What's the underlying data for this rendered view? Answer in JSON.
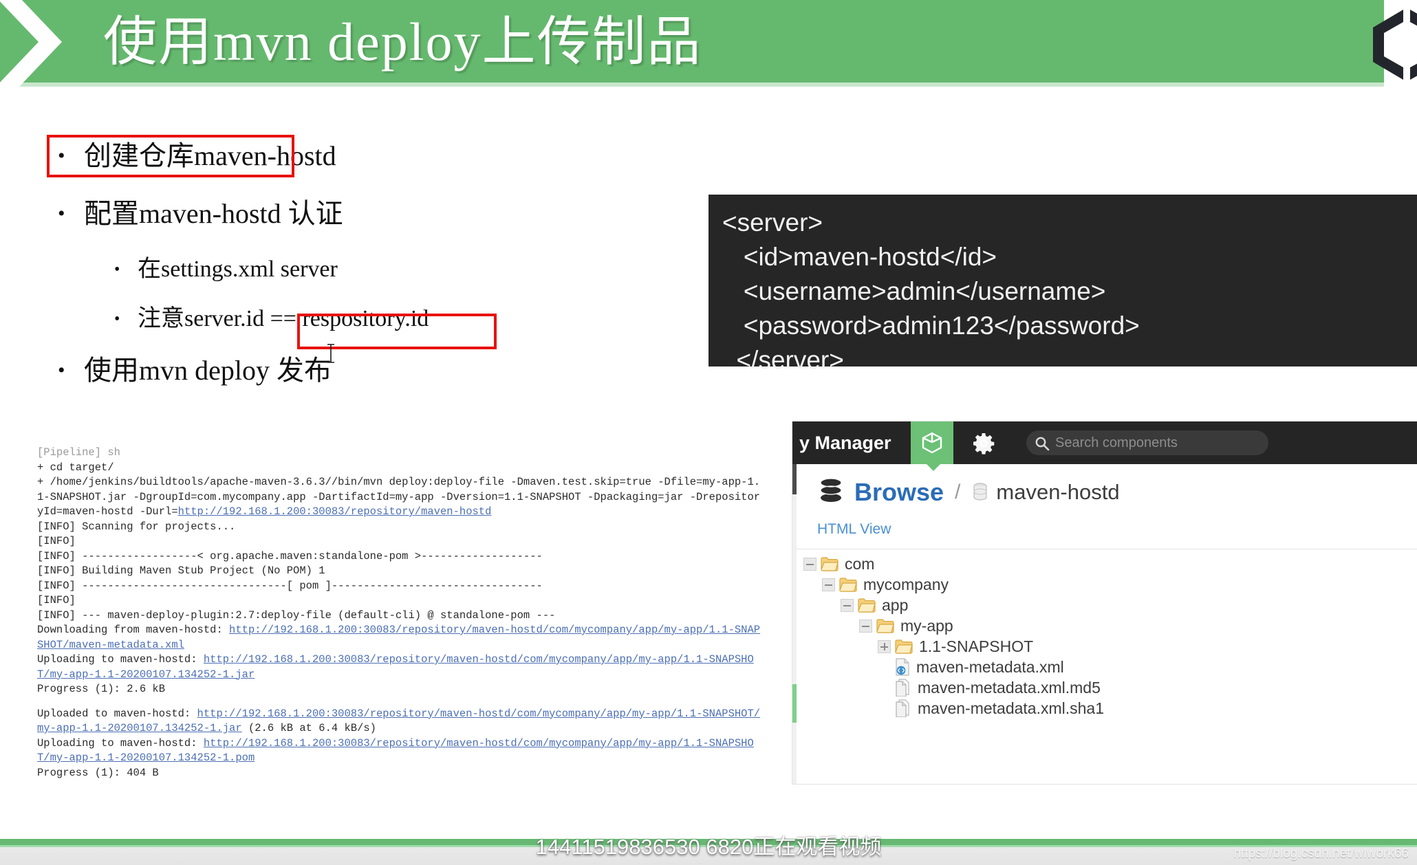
{
  "header": {
    "title": "使用mvn deploy上传制品",
    "chevron_icon": "chevron-right-icon",
    "logo_icon": "nexus-hexagon-logo-icon",
    "band_color": "#65b96e"
  },
  "bullets": {
    "items": [
      {
        "level": 1,
        "cn": "创建仓库",
        "code": "maven-hostd",
        "tail": "",
        "highlight": true
      },
      {
        "level": 1,
        "cn": "配置",
        "code": "maven-hostd",
        "tail": " 认证",
        "highlight": false
      },
      {
        "level": 2,
        "cn": "在",
        "code": "settings.xml server",
        "tail": "",
        "highlight": false
      },
      {
        "level": 2,
        "cn": "注意",
        "code": "server.id == ",
        "tail": "",
        "highlight": false,
        "boxed_code": "respository.id"
      },
      {
        "level": 1,
        "cn": "使用",
        "code": "mvn deploy",
        "tail": " 发布",
        "highlight": false
      }
    ],
    "full_lines": [
      "创建仓库maven-hostd",
      "配置maven-hostd 认证",
      "在settings.xml server",
      "注意server.id == respository.id",
      "使用mvn deploy 发布"
    ],
    "highlight_color": "#e8120d"
  },
  "xml_block": {
    "lines": [
      "<server>",
      "   <id>maven-hostd</id>",
      "   <username>admin</username>",
      "   <password>admin123</password>",
      "  </server>"
    ],
    "background": "#262626",
    "text_color": "#f2f2f2"
  },
  "console": {
    "lines": [
      {
        "text": "[Pipeline] sh",
        "style": "gray"
      },
      {
        "text": "+ cd target/",
        "style": "plain"
      },
      {
        "text": "+ /home/jenkins/buildtools/apache-maven-3.6.3//bin/mvn deploy:deploy-file -Dmaven.test.skip=true -Dfile=my-app-1.1-SNAPSHOT.jar -DgroupId=com.mycompany.app -DartifactId=my-app -Dversion=1.1-SNAPSHOT -Dpackaging=jar -DrepositoryId=maven-hostd -Durl=",
        "style": "plain",
        "url": "http://192.168.1.200:30083/repository/maven-hostd"
      },
      {
        "text": "[INFO] Scanning for projects...",
        "style": "plain"
      },
      {
        "text": "[INFO]",
        "style": "plain"
      },
      {
        "text": "[INFO] ------------------< org.apache.maven:standalone-pom >-------------------",
        "style": "plain"
      },
      {
        "text": "[INFO] Building Maven Stub Project (No POM) 1",
        "style": "plain"
      },
      {
        "text": "[INFO] --------------------------------[ pom ]---------------------------------",
        "style": "plain"
      },
      {
        "text": "[INFO]",
        "style": "plain"
      },
      {
        "text": "[INFO] --- maven-deploy-plugin:2.7:deploy-file (default-cli) @ standalone-pom ---",
        "style": "plain"
      },
      {
        "text": "Downloading from maven-hostd: ",
        "style": "plain",
        "url": "http://192.168.1.200:30083/repository/maven-hostd/com/mycompany/app/my-app/1.1-SNAPSHOT/maven-metadata.xml"
      },
      {
        "text": "Uploading to maven-hostd: ",
        "style": "plain",
        "url": "http://192.168.1.200:30083/repository/maven-hostd/com/mycompany/app/my-app/1.1-SNAPSHOT/my-app-1.1-20200107.134252-1.jar"
      },
      {
        "text": "Progress (1): 2.6 kB",
        "style": "plain"
      },
      {
        "text": "",
        "style": "spacer"
      },
      {
        "text": "Uploaded to maven-hostd: ",
        "style": "plain",
        "url": "http://192.168.1.200:30083/repository/maven-hostd/com/mycompany/app/my-app/1.1-SNAPSHOT/my-app-1.1-20200107.134252-1.jar",
        "suffix": " (2.6 kB at 6.4 kB/s)"
      },
      {
        "text": "Uploading to maven-hostd: ",
        "style": "plain",
        "url": "http://192.168.1.200:30083/repository/maven-hostd/com/mycompany/app/my-app/1.1-SNAPSHOT/my-app-1.1-20200107.134252-1.pom"
      },
      {
        "text": "Progress (1): 404 B",
        "style": "plain"
      }
    ]
  },
  "nexus": {
    "topbar_title": "y Manager",
    "tab_browse_icon": "cube-icon",
    "gear_icon": "gear-icon",
    "search": {
      "placeholder": "Search components",
      "value": "",
      "icon": "search-icon"
    },
    "breadcrumb": {
      "root_icon": "database-stack-icon",
      "root_label": "Browse",
      "separator": "/",
      "repo_icon": "repository-icon",
      "repo_label": "maven-hostd"
    },
    "html_view_link": "HTML View",
    "tree": [
      {
        "label": "com",
        "indent": 0,
        "toggle": "minus",
        "icon": "folder-open-icon"
      },
      {
        "label": "mycompany",
        "indent": 1,
        "toggle": "minus",
        "icon": "folder-open-icon"
      },
      {
        "label": "app",
        "indent": 2,
        "toggle": "minus",
        "icon": "folder-open-icon"
      },
      {
        "label": "my-app",
        "indent": 3,
        "toggle": "minus",
        "icon": "folder-open-icon"
      },
      {
        "label": "1.1-SNAPSHOT",
        "indent": 4,
        "toggle": "plus",
        "icon": "folder-open-icon"
      },
      {
        "label": "maven-metadata.xml",
        "indent": 4,
        "toggle": "none",
        "icon": "xml-file-icon"
      },
      {
        "label": "maven-metadata.xml.md5",
        "indent": 4,
        "toggle": "none",
        "icon": "file-icon"
      },
      {
        "label": "maven-metadata.xml.sha1",
        "indent": 4,
        "toggle": "none",
        "icon": "file-icon"
      }
    ],
    "accent_color": "#6cc176",
    "link_color": "#2b6cb8"
  },
  "footer": {
    "overlay_text": "14411519836530 6820正在观看视频",
    "watermark": "https://blog.csdn.net/wlwork66",
    "bar_color": "#67b873"
  }
}
